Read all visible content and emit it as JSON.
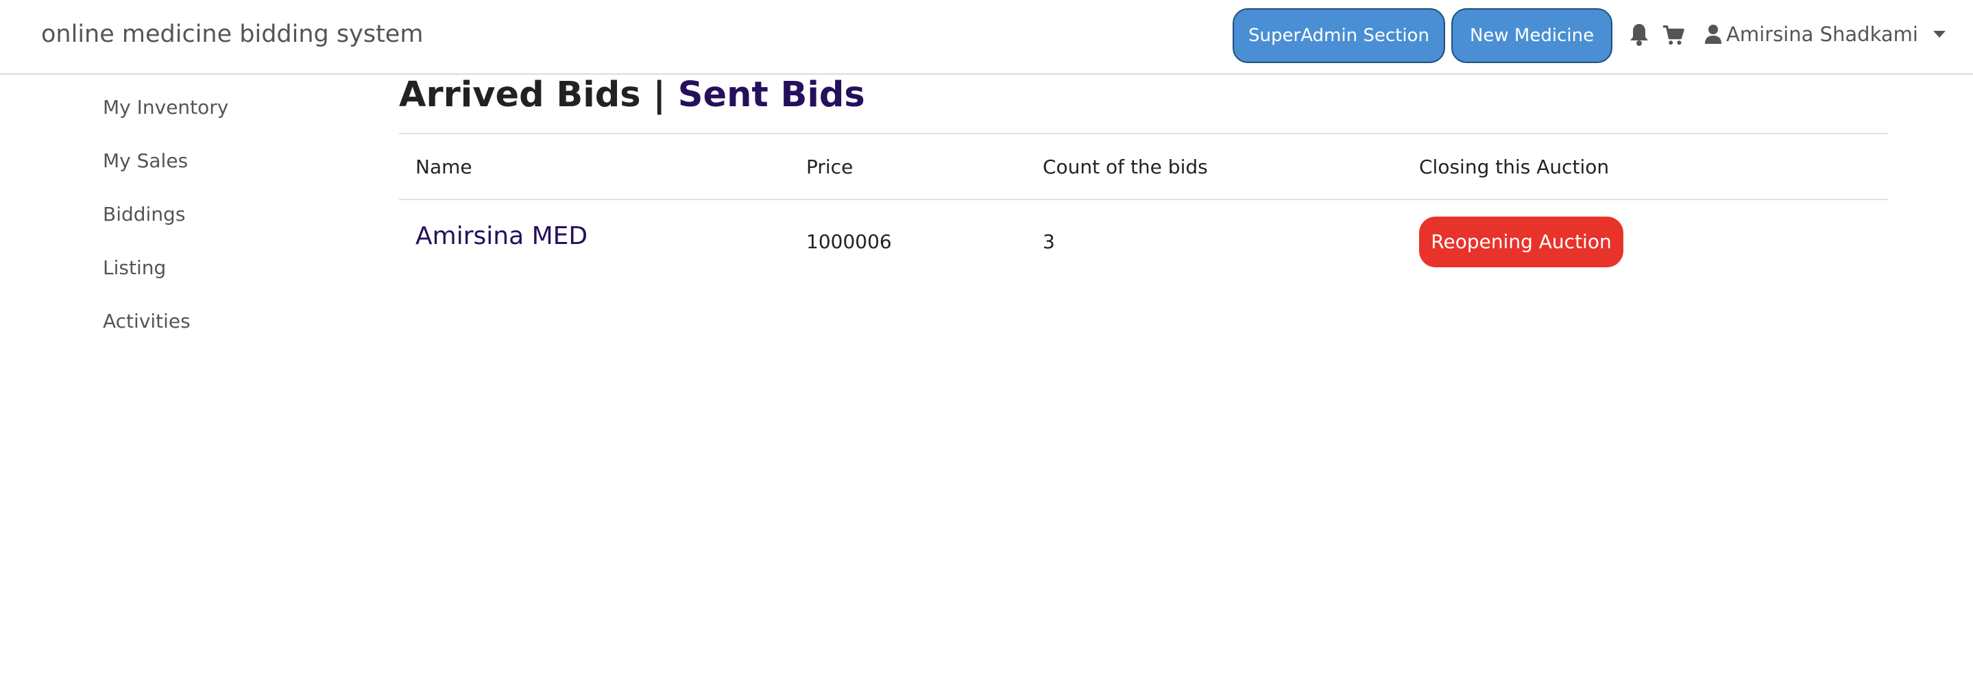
{
  "navbar": {
    "brand": "online medicine bidding system",
    "buttons": {
      "superadmin": "SuperAdmin Section",
      "new_medicine": "New Medicine"
    },
    "icons": [
      "bell-icon",
      "cart-icon",
      "user-icon"
    ],
    "user_name": "Amirsina Shadkami",
    "button_color": "#4a8fd3"
  },
  "sidebar": {
    "items": [
      {
        "label": "My Inventory"
      },
      {
        "label": "My Sales"
      },
      {
        "label": "Biddings"
      },
      {
        "label": "Listing"
      },
      {
        "label": "Activities"
      }
    ]
  },
  "main": {
    "heading": {
      "arrived": "Arrived Bids",
      "separator": "|",
      "sent": "Sent Bids"
    },
    "table": {
      "headers": [
        "Name",
        "Price",
        "Count of the bids",
        "Closing this Auction"
      ],
      "rows": [
        {
          "name": "Amirsina MED",
          "price": "1000006",
          "count": "3",
          "action": "Reopening Auction"
        }
      ]
    },
    "link_color": "#24105c",
    "danger_color": "#e8332b"
  }
}
